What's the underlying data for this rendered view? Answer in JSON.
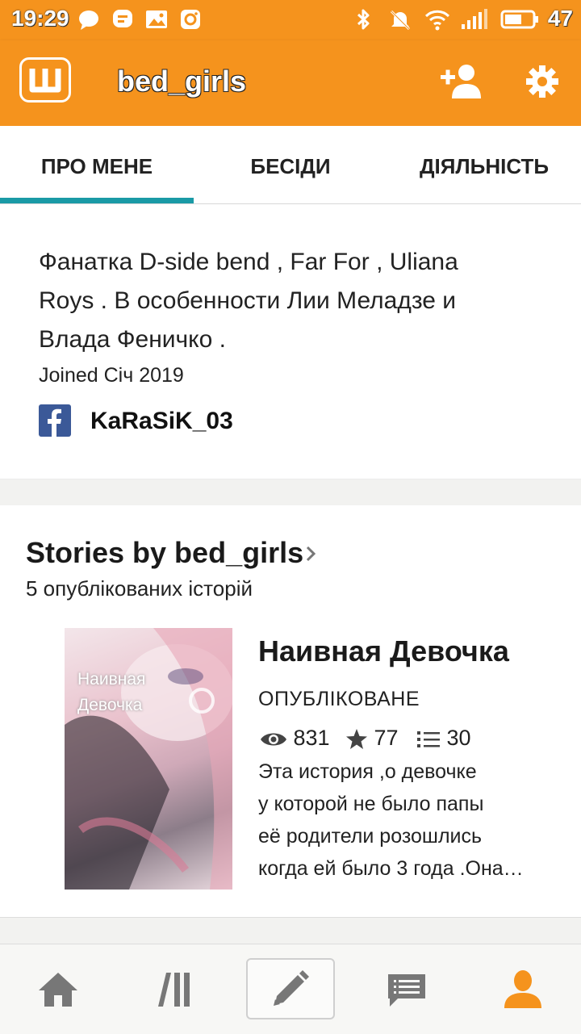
{
  "status_bar": {
    "time": "19:29",
    "battery": "47",
    "icons": [
      "chat-bubble-icon",
      "message-icon",
      "image-icon",
      "instagram-icon",
      "bluetooth-icon",
      "mute-icon",
      "wifi-icon",
      "signal-icon",
      "battery-icon"
    ]
  },
  "app_bar": {
    "title": "bed_girls",
    "logo_icon": "wattpad-logo-icon",
    "actions": [
      "follow-user-icon",
      "settings-gear-icon"
    ]
  },
  "tabs": [
    {
      "label": "ПРО МЕНЕ",
      "active": true
    },
    {
      "label": "БЕСІДИ",
      "active": false
    },
    {
      "label": "ДІЯЛЬНІСТЬ",
      "active": false
    }
  ],
  "about": {
    "bio_line1": "Фанатка D-side bend , Far For , Uliana",
    "bio_line2": "Roys . В особенности Лии Меладзе и",
    "bio_line3": "Влада Феничко .",
    "joined": "Joined Січ 2019",
    "facebook_name": "KaRaSiK_03"
  },
  "stories": {
    "heading": "Stories by bed_girls",
    "count_text": "5 опублікованих історій",
    "items": [
      {
        "cover_text_line1": "Наивная",
        "cover_text_line2": "Девочка",
        "title": "Наивная Девочка",
        "status": "ОПУБЛІКОВАНЕ",
        "views": "831",
        "votes": "77",
        "parts": "30",
        "desc_line1": "Эта история ,о девочке",
        "desc_line2": "у которой не было папы",
        "desc_line3": "её родители розошлись",
        "desc_line4": "когда ей было 3 года .Она…"
      }
    ]
  },
  "bottom_nav": [
    "home-icon",
    "library-icon",
    "write-pencil-icon",
    "messages-icon",
    "profile-icon"
  ],
  "colors": {
    "brand_orange": "#f5931d",
    "tab_accent": "#1a9aa6",
    "active_nav": "#f5931d",
    "inactive_nav": "#777777",
    "facebook_blue": "#3b5998"
  }
}
